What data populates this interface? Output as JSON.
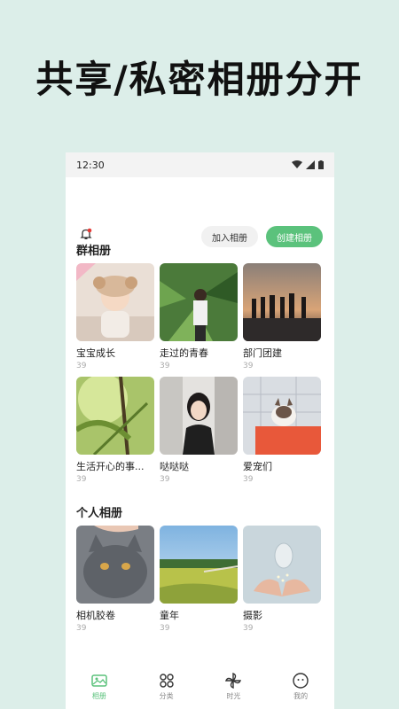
{
  "headline": "共享/私密相册分开",
  "status": {
    "time": "12:30"
  },
  "header": {
    "join_label": "加入相册",
    "create_label": "创建相册"
  },
  "group_section": {
    "title": "群相册",
    "albums": [
      {
        "title": "宝宝成长",
        "count": "39"
      },
      {
        "title": "走过的青春",
        "count": "39"
      },
      {
        "title": "部门团建",
        "count": "39"
      },
      {
        "title": "生活开心的事...",
        "count": "39"
      },
      {
        "title": "哒哒哒",
        "count": "39"
      },
      {
        "title": "爱宠们",
        "count": "39"
      }
    ]
  },
  "personal_section": {
    "title": "个人相册",
    "albums": [
      {
        "title": "相机胶卷",
        "count": "39"
      },
      {
        "title": "童年",
        "count": "39"
      },
      {
        "title": "摄影",
        "count": "39"
      }
    ]
  },
  "tabs": [
    {
      "label": "相册",
      "icon": "photo-album-icon",
      "active": true
    },
    {
      "label": "分类",
      "icon": "category-grid-icon",
      "active": false
    },
    {
      "label": "时光",
      "icon": "pinwheel-icon",
      "active": false
    },
    {
      "label": "我的",
      "icon": "smiley-face-icon",
      "active": false
    }
  ],
  "colors": {
    "accent": "#5bc27c",
    "background": "#dceee9",
    "notification_dot": "#e53935"
  }
}
